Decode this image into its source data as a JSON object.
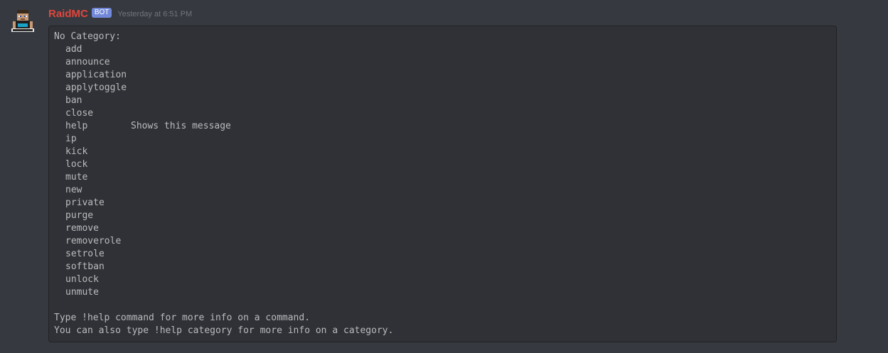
{
  "author": {
    "name": "RaidMC",
    "tag": "BOT",
    "timestamp": "Yesterday at 6:51 PM",
    "avatar_icon": "minecraft-skin-avatar-icon",
    "name_color": "#e0473d"
  },
  "help": {
    "category": "No Category:",
    "commands": [
      {
        "name": "add",
        "desc": ""
      },
      {
        "name": "announce",
        "desc": ""
      },
      {
        "name": "application",
        "desc": ""
      },
      {
        "name": "applytoggle",
        "desc": ""
      },
      {
        "name": "ban",
        "desc": ""
      },
      {
        "name": "close",
        "desc": ""
      },
      {
        "name": "help",
        "desc": "Shows this message"
      },
      {
        "name": "ip",
        "desc": ""
      },
      {
        "name": "kick",
        "desc": ""
      },
      {
        "name": "lock",
        "desc": ""
      },
      {
        "name": "mute",
        "desc": ""
      },
      {
        "name": "new",
        "desc": ""
      },
      {
        "name": "private",
        "desc": ""
      },
      {
        "name": "purge",
        "desc": ""
      },
      {
        "name": "remove",
        "desc": ""
      },
      {
        "name": "removerole",
        "desc": ""
      },
      {
        "name": "setrole",
        "desc": ""
      },
      {
        "name": "softban",
        "desc": ""
      },
      {
        "name": "unlock",
        "desc": ""
      },
      {
        "name": "unmute",
        "desc": ""
      }
    ],
    "footer_line1": "Type !help command for more info on a command.",
    "footer_line2": "You can also type !help category for more info on a category."
  }
}
